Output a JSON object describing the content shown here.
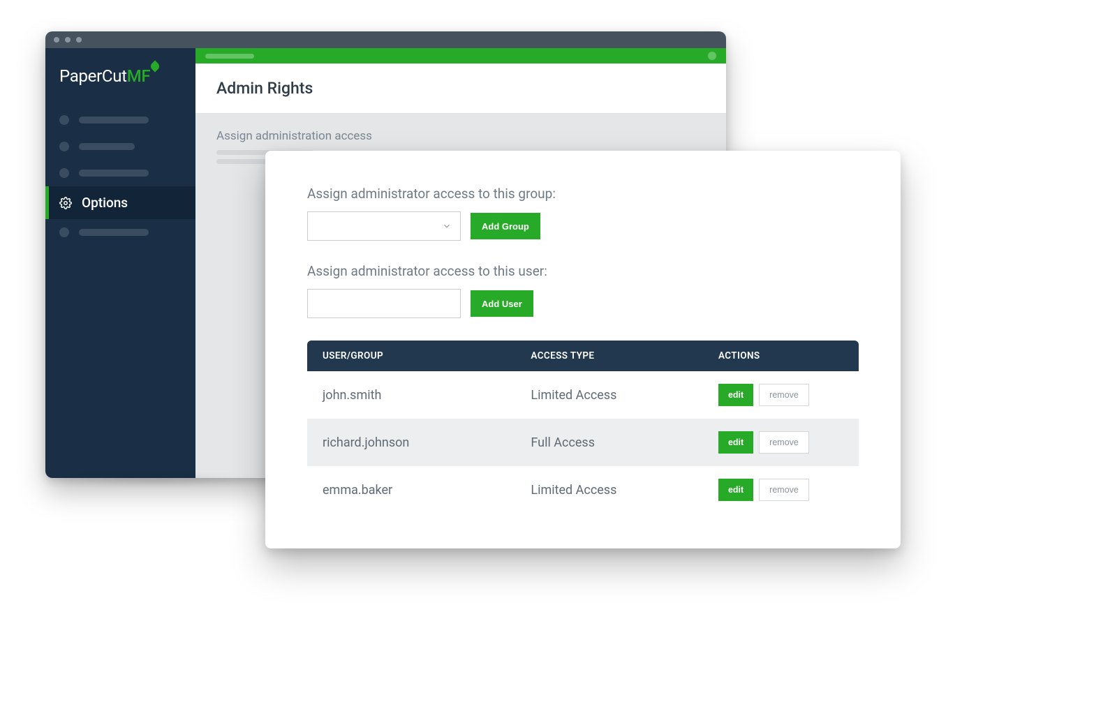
{
  "brand": {
    "name1": "PaperCut",
    "name2": "MF"
  },
  "sidebar": {
    "active_label": "Options"
  },
  "page": {
    "title": "Admin Rights",
    "section_title": "Assign administration access"
  },
  "card": {
    "group_label": "Assign administrator access to this group:",
    "add_group_btn": "Add Group",
    "user_label": "Assign administrator access to this user:",
    "add_user_btn": "Add User"
  },
  "table": {
    "headers": {
      "user": "USER/GROUP",
      "access": "ACCESS TYPE",
      "actions": "ACTIONS"
    },
    "edit_btn": "edit",
    "remove_btn": "remove",
    "rows": [
      {
        "user": "john.smith",
        "access": "Limited Access"
      },
      {
        "user": "richard.johnson",
        "access": "Full Access"
      },
      {
        "user": "emma.baker",
        "access": "Limited Access"
      }
    ]
  }
}
